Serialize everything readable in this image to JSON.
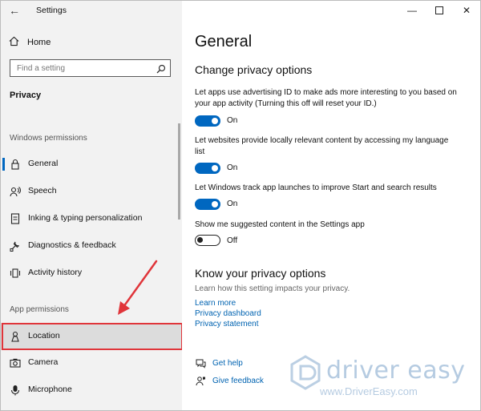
{
  "window": {
    "title": "Settings"
  },
  "sidebar": {
    "home_label": "Home",
    "search_placeholder": "Find a setting",
    "current_section": "Privacy",
    "windows_permissions_label": "Windows permissions",
    "app_permissions_label": "App permissions",
    "items": [
      {
        "label": "General",
        "icon": "lock-icon",
        "selected": true
      },
      {
        "label": "Speech",
        "icon": "speech-icon"
      },
      {
        "label": "Inking & typing personalization",
        "icon": "inking-icon"
      },
      {
        "label": "Diagnostics & feedback",
        "icon": "diagnostics-icon"
      },
      {
        "label": "Activity history",
        "icon": "activity-icon"
      },
      {
        "label": "Location",
        "icon": "location-icon",
        "highlighted": true
      },
      {
        "label": "Camera",
        "icon": "camera-icon"
      },
      {
        "label": "Microphone",
        "icon": "microphone-icon"
      }
    ]
  },
  "main": {
    "title": "General",
    "section1_heading": "Change privacy options",
    "options": [
      {
        "description": "Let apps use advertising ID to make ads more interesting to you based on your app activity (Turning this off will reset your ID.)",
        "state": "On"
      },
      {
        "description": "Let websites provide locally relevant content by accessing my language list",
        "state": "On"
      },
      {
        "description": "Let Windows track app launches to improve Start and search results",
        "state": "On"
      },
      {
        "description": "Show me suggested content in the Settings app",
        "state": "Off"
      }
    ],
    "section2_heading": "Know your privacy options",
    "section2_desc": "Learn how this setting impacts your privacy.",
    "links": [
      "Learn more",
      "Privacy dashboard",
      "Privacy statement"
    ],
    "help": {
      "get_help": "Get help",
      "give_feedback": "Give feedback"
    }
  },
  "watermark": {
    "name": "driver easy",
    "url": "www.DriverEasy.com"
  },
  "colors": {
    "accent": "#0067c0",
    "link": "#0063b1",
    "annotation": "#e0353a"
  }
}
